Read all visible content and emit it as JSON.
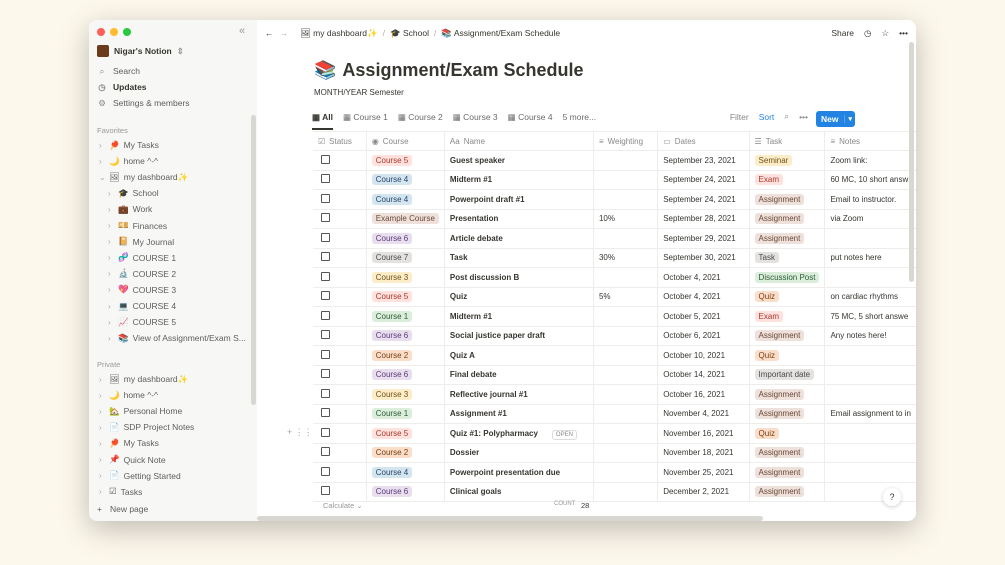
{
  "workspace": "Nigar's Notion",
  "sidebar": {
    "top": [
      {
        "icon": "search-icon",
        "label": "Search"
      },
      {
        "icon": "clock-icon",
        "label": "Updates"
      },
      {
        "icon": "gear-icon",
        "label": "Settings & members"
      }
    ],
    "favorites_label": "Favorites",
    "favorites": [
      {
        "emoji": "🏓",
        "label": "My Tasks",
        "depth": 0
      },
      {
        "emoji": "🌙",
        "label": "home ^-^",
        "depth": 0
      },
      {
        "emoji": "🖼",
        "label": "my dashboard",
        "suffix": "✨",
        "depth": 0,
        "open": true
      },
      {
        "emoji": "🎓",
        "label": "School",
        "depth": 1
      },
      {
        "emoji": "💼",
        "label": "Work",
        "depth": 1
      },
      {
        "emoji": "💴",
        "label": "Finances",
        "depth": 1
      },
      {
        "emoji": "📔",
        "label": "My Journal",
        "depth": 1
      },
      {
        "emoji": "🧬",
        "label": "COURSE 1",
        "depth": 1
      },
      {
        "emoji": "🔬",
        "label": "COURSE 2",
        "depth": 1
      },
      {
        "emoji": "💖",
        "label": "COURSE 3",
        "depth": 1
      },
      {
        "emoji": "💻",
        "label": "COURSE 4",
        "depth": 1
      },
      {
        "emoji": "📈",
        "label": "COURSE 5",
        "depth": 1
      },
      {
        "emoji": "📚",
        "label": "View of Assignment/Exam S...",
        "depth": 1
      }
    ],
    "private_label": "Private",
    "private": [
      {
        "emoji": "🖼",
        "label": "my dashboard",
        "suffix": "✨"
      },
      {
        "emoji": "🌙",
        "label": "home ^-^"
      },
      {
        "emoji": "🏡",
        "label": "Personal Home"
      },
      {
        "emoji": "📄",
        "label": "SDP Project Notes"
      },
      {
        "emoji": "🏓",
        "label": "My Tasks"
      },
      {
        "emoji": "📌",
        "label": "Quick Note"
      },
      {
        "emoji": "📄",
        "label": "Getting Started"
      },
      {
        "emoji": "☑",
        "label": "Tasks"
      }
    ],
    "new_page": "New page"
  },
  "topbar": {
    "crumbs": [
      {
        "emoji": "🖼",
        "label": "my dashboard✨"
      },
      {
        "emoji": "🎓",
        "label": "School"
      },
      {
        "emoji": "📚",
        "label": "Assignment/Exam Schedule"
      }
    ],
    "share": "Share"
  },
  "page": {
    "emoji": "📚",
    "title": "Assignment/Exam Schedule",
    "subtitle": "MONTH/YEAR Semester"
  },
  "tabs": [
    "All",
    "Course 1",
    "Course 2",
    "Course 3",
    "Course 4",
    "5 more..."
  ],
  "actions": {
    "filter": "Filter",
    "sort": "Sort",
    "new": "New"
  },
  "columns": [
    "Status",
    "Course",
    "Name",
    "Weighting",
    "Dates",
    "Task",
    "Notes"
  ],
  "colors": {
    "red": [
      "#ffe2dd",
      "#a8382d"
    ],
    "blue": [
      "#d3e5ef",
      "#28456c"
    ],
    "brown": [
      "#eee0da",
      "#6b4a38"
    ],
    "purple": [
      "#e8deee",
      "#5a3a7a"
    ],
    "gray": [
      "#e3e2e0",
      "#4a4a48"
    ],
    "yellow": [
      "#fdecc8",
      "#6e5218"
    ],
    "green": [
      "#dbeddb",
      "#2b5c34"
    ],
    "orange": [
      "#fadec9",
      "#7a3d10"
    ]
  },
  "rows": [
    {
      "course": "Course 5",
      "cc": "red",
      "name": "Guest speaker",
      "weight": "",
      "date": "September 23, 2021",
      "task": "Seminar",
      "tc": "yellow",
      "notes": "Zoom link:"
    },
    {
      "course": "Course 4",
      "cc": "blue",
      "name": "Midterm #1",
      "weight": "",
      "date": "September 24, 2021",
      "task": "Exam",
      "tc": "red",
      "notes": "60 MC, 10 short answ"
    },
    {
      "course": "Course 4",
      "cc": "blue",
      "name": "Powerpoint draft #1",
      "weight": "",
      "date": "September 24, 2021",
      "task": "Assignment",
      "tc": "brown",
      "notes": "Email to instructor."
    },
    {
      "course": "Example Course",
      "cc": "brown",
      "name": "Presentation",
      "weight": "10%",
      "date": "September 28, 2021",
      "task": "Assignment",
      "tc": "brown",
      "notes": "via Zoom"
    },
    {
      "course": "Course 6",
      "cc": "purple",
      "name": "Article debate",
      "weight": "",
      "date": "September 29, 2021",
      "task": "Assignment",
      "tc": "brown",
      "notes": ""
    },
    {
      "course": "Course 7",
      "cc": "gray",
      "name": "Task",
      "weight": "30%",
      "date": "September 30, 2021",
      "task": "Task",
      "tc": "gray",
      "notes": "put notes here"
    },
    {
      "course": "Course 3",
      "cc": "yellow",
      "name": "Post discussion B",
      "weight": "",
      "date": "October 4, 2021",
      "task": "Discussion Post",
      "tc": "green",
      "notes": ""
    },
    {
      "course": "Course 5",
      "cc": "red",
      "name": "Quiz",
      "weight": "5%",
      "date": "October 4, 2021",
      "task": "Quiz",
      "tc": "orange",
      "notes": "on cardiac rhythms"
    },
    {
      "course": "Course 1",
      "cc": "green",
      "name": "Midterm #1",
      "weight": "",
      "date": "October 5, 2021",
      "task": "Exam",
      "tc": "red",
      "notes": "75 MC, 5 short answe"
    },
    {
      "course": "Course 6",
      "cc": "purple",
      "name": "Social justice paper draft",
      "weight": "",
      "date": "October 6, 2021",
      "task": "Assignment",
      "tc": "brown",
      "notes": "Any notes here!"
    },
    {
      "course": "Course 2",
      "cc": "orange",
      "name": "Quiz A",
      "weight": "",
      "date": "October 10, 2021",
      "task": "Quiz",
      "tc": "orange",
      "notes": ""
    },
    {
      "course": "Course 6",
      "cc": "purple",
      "name": "Final debate",
      "weight": "",
      "date": "October 14, 2021",
      "task": "Important date",
      "tc": "gray",
      "notes": ""
    },
    {
      "course": "Course 3",
      "cc": "yellow",
      "name": "Reflective journal #1",
      "weight": "",
      "date": "October 16, 2021",
      "task": "Assignment",
      "tc": "brown",
      "notes": ""
    },
    {
      "course": "Course 1",
      "cc": "green",
      "name": "Assignment #1",
      "weight": "",
      "date": "November 4, 2021",
      "task": "Assignment",
      "tc": "brown",
      "notes": "Email assignment to in"
    },
    {
      "course": "Course 5",
      "cc": "red",
      "name": "Quiz #1: Polypharmacy",
      "weight": "",
      "date": "November 16, 2021",
      "task": "Quiz",
      "tc": "orange",
      "notes": "",
      "open": "OPEN"
    },
    {
      "course": "Course 2",
      "cc": "orange",
      "name": "Dossier",
      "weight": "",
      "date": "November 18, 2021",
      "task": "Assignment",
      "tc": "brown",
      "notes": ""
    },
    {
      "course": "Course 4",
      "cc": "blue",
      "name": "Powerpoint presentation due",
      "weight": "",
      "date": "November 25, 2021",
      "task": "Assignment",
      "tc": "brown",
      "notes": ""
    },
    {
      "course": "Course 6",
      "cc": "purple",
      "name": "Clinical goals",
      "weight": "",
      "date": "December 2, 2021",
      "task": "Assignment",
      "tc": "brown",
      "notes": ""
    }
  ],
  "footer": {
    "calculate": "Calculate",
    "count_label": "COUNT",
    "count": "28"
  },
  "help": "?"
}
